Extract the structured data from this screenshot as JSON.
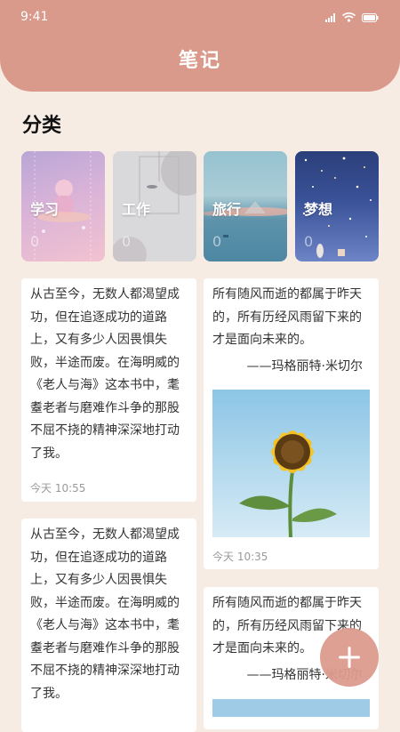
{
  "status": {
    "time": "9:41"
  },
  "header": {
    "title": "笔记"
  },
  "section": {
    "title": "分类"
  },
  "categories": [
    {
      "name": "学习",
      "count": "0"
    },
    {
      "name": "工作",
      "count": "0"
    },
    {
      "name": "旅行",
      "count": "0"
    },
    {
      "name": "梦想",
      "count": "0"
    }
  ],
  "notes": [
    {
      "text": "从古至今，无数人都渴望成功，但在追逐成功的道路上，又有多少人因畏惧失败，半途而废。在海明威的《老人与海》这本书中，耄耋老者与磨难作斗争的那股不屈不挠的精神深深地打动了我。",
      "time": "今天 10:55"
    },
    {
      "text": "所有随风而逝的都属于昨天的，所有历经风雨留下来的才是面向未来的。",
      "author": "——玛格丽特·米切尔",
      "time": "今天 10:35"
    },
    {
      "text": "从古至今，无数人都渴望成功，但在追逐成功的道路上，又有多少人因畏惧失败，半途而废。在海明威的《老人与海》这本书中，耄耋老者与磨难作斗争的那股不屈不挠的精神深深地打动了我。"
    },
    {
      "text": "所有随风而逝的都属于昨天的，所有历经风雨留下来的才是面向未来的。",
      "author": "——玛格丽特·米切尔"
    }
  ],
  "fab": {
    "icon": "plus-icon"
  }
}
